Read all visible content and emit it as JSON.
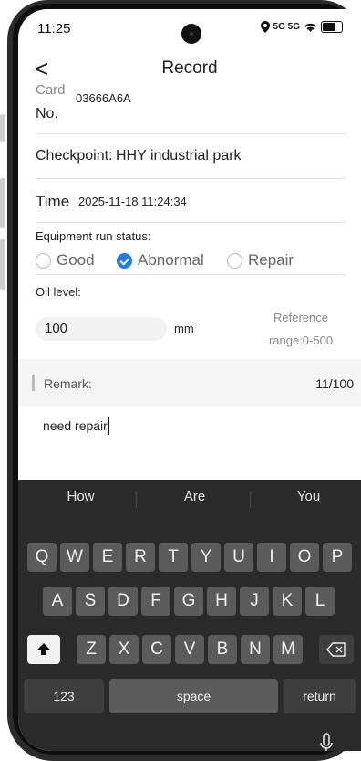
{
  "status_bar": {
    "time": "11:25",
    "signal": "5G 5G"
  },
  "header": {
    "title": "Record",
    "back": "<"
  },
  "form": {
    "card_label_top": "Card",
    "card_label_bottom": "No.",
    "card_value": "03666A6A",
    "checkpoint_label": "Checkpoint:",
    "checkpoint_value": "HHY industrial park",
    "time_label": "Time",
    "time_value": "2025-11-18 11:24:34",
    "equipment_label": "Equipment run status:",
    "options": [
      "Good",
      "Abnormal",
      "Repair"
    ],
    "selected_option": "Abnormal",
    "oil_label": "Oil level:",
    "oil_value": "100",
    "oil_unit": "mm",
    "reference_line1": "Reference",
    "reference_line2": "range:0-500",
    "remark_label": "Remark:",
    "remark_count": "11/100",
    "remark_text": "need repair"
  },
  "keyboard": {
    "suggestions": [
      "How",
      "Are",
      "You"
    ],
    "row1": [
      "Q",
      "W",
      "E",
      "R",
      "T",
      "Y",
      "U",
      "I",
      "O",
      "P"
    ],
    "row2": [
      "A",
      "S",
      "D",
      "F",
      "G",
      "H",
      "J",
      "K",
      "L"
    ],
    "row3": [
      "Z",
      "X",
      "C",
      "V",
      "B",
      "N",
      "M"
    ],
    "numbers": "123",
    "space": "space",
    "return": "return",
    "shift_icon": "shift-icon",
    "delete_icon": "backspace-icon",
    "mic_icon": "microphone-icon"
  }
}
